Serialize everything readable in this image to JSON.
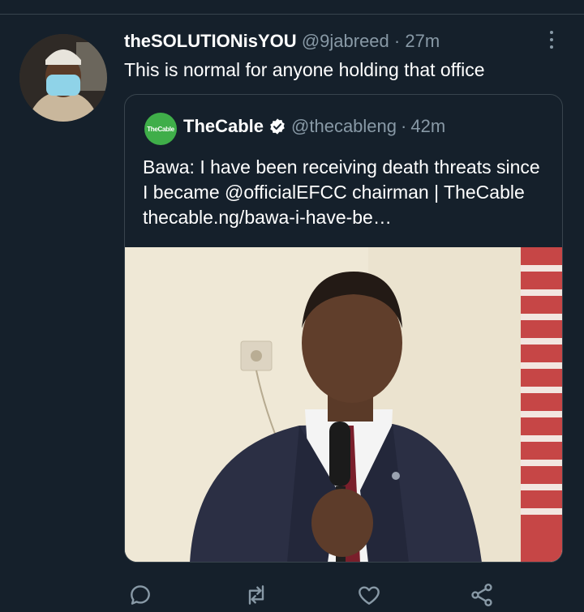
{
  "tweet": {
    "display_name": "theSOLUTIONisYOU",
    "handle": "@9jabreed",
    "time": "27m",
    "separator": "·",
    "text": "This is normal for anyone holding that office"
  },
  "quoted": {
    "avatar_text": "TheCable",
    "display_name": "TheCable",
    "handle": "@thecableng",
    "separator": "·",
    "time": "42m",
    "text": "Bawa: I have been receiving death threats since I became @officialEFCC  chairman | TheCable thecable.ng/bawa-i-have-be…"
  },
  "colors": {
    "background": "#15202b",
    "border": "#38444d",
    "secondary_text": "#8899a6",
    "brand_green": "#3fae49"
  },
  "icons": {
    "more": "more-vertical-icon",
    "verified": "verified-badge-icon",
    "reply": "reply-icon",
    "retweet": "retweet-icon",
    "like": "heart-icon",
    "share": "share-icon"
  }
}
